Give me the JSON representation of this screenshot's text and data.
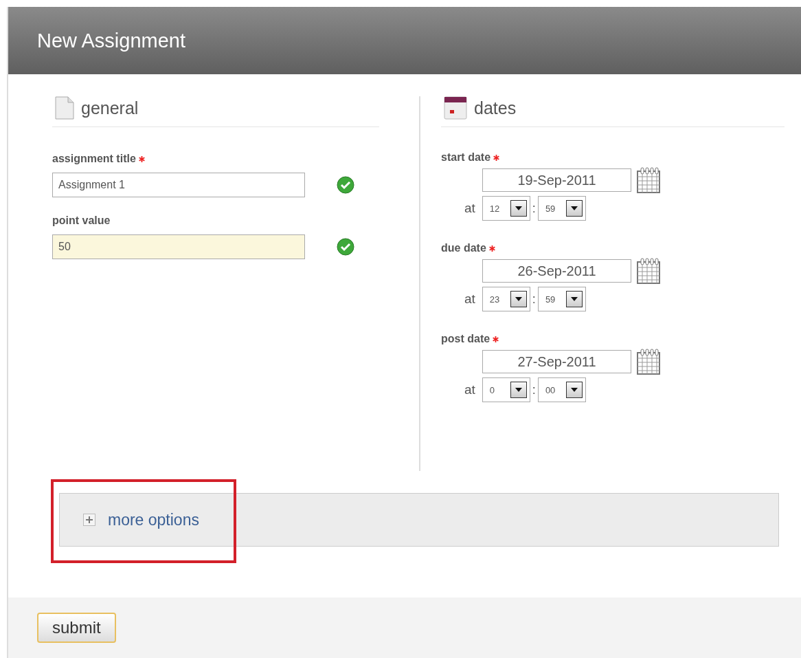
{
  "header": {
    "title": "New Assignment"
  },
  "general": {
    "heading": "general",
    "fields": [
      {
        "label": "assignment title",
        "required": true,
        "value": "Assignment 1",
        "focused": false,
        "valid": true
      },
      {
        "label": "point value",
        "required": false,
        "value": "50",
        "focused": true,
        "valid": true
      }
    ]
  },
  "dates": {
    "heading": "dates",
    "items": [
      {
        "label": "start date",
        "required": true,
        "date": "19-Sep-2011",
        "at_label": "at",
        "hour": "12",
        "separator": ":",
        "minute": "59"
      },
      {
        "label": "due date",
        "required": true,
        "date": "26-Sep-2011",
        "at_label": "at",
        "hour": "23",
        "separator": ":",
        "minute": "59"
      },
      {
        "label": "post date",
        "required": true,
        "date": "27-Sep-2011",
        "at_label": "at",
        "hour": "0",
        "separator": ":",
        "minute": "00"
      }
    ]
  },
  "more_options": {
    "label": "more options",
    "expanded": false,
    "highlighted": true
  },
  "submit": "submit"
}
